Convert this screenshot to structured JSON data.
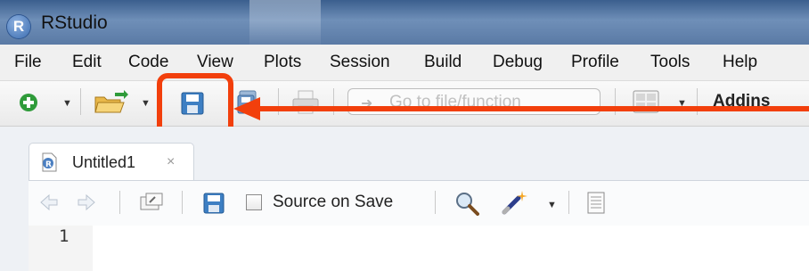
{
  "window": {
    "title": "RStudio",
    "app_icon_letter": "R"
  },
  "menu": {
    "items": [
      {
        "label": "File"
      },
      {
        "label": "Edit"
      },
      {
        "label": "Code"
      },
      {
        "label": "View"
      },
      {
        "label": "Plots"
      },
      {
        "label": "Session"
      },
      {
        "label": "Build"
      },
      {
        "label": "Debug"
      },
      {
        "label": "Profile"
      },
      {
        "label": "Tools"
      },
      {
        "label": "Help"
      }
    ]
  },
  "toolbar": {
    "goto_placeholder": "Go to file/function",
    "addins_label": "Addins",
    "icons": [
      "new-file-icon",
      "open-folder-icon",
      "save-icon",
      "save-all-icon",
      "print-icon",
      "grid-layout-icon"
    ]
  },
  "annotation": {
    "highlight_color": "#f23f0c",
    "target": "save-icon"
  },
  "editor": {
    "tab": {
      "label": "Untitled1",
      "close": "×"
    },
    "source_on_save_label": "Source on Save",
    "source_on_save_checked": false,
    "line_numbers": [
      "1"
    ],
    "icons": [
      "back-icon",
      "forward-icon",
      "show-in-window-icon",
      "save-icon",
      "search-icon",
      "magic-wand-icon",
      "compile-report-icon"
    ]
  }
}
